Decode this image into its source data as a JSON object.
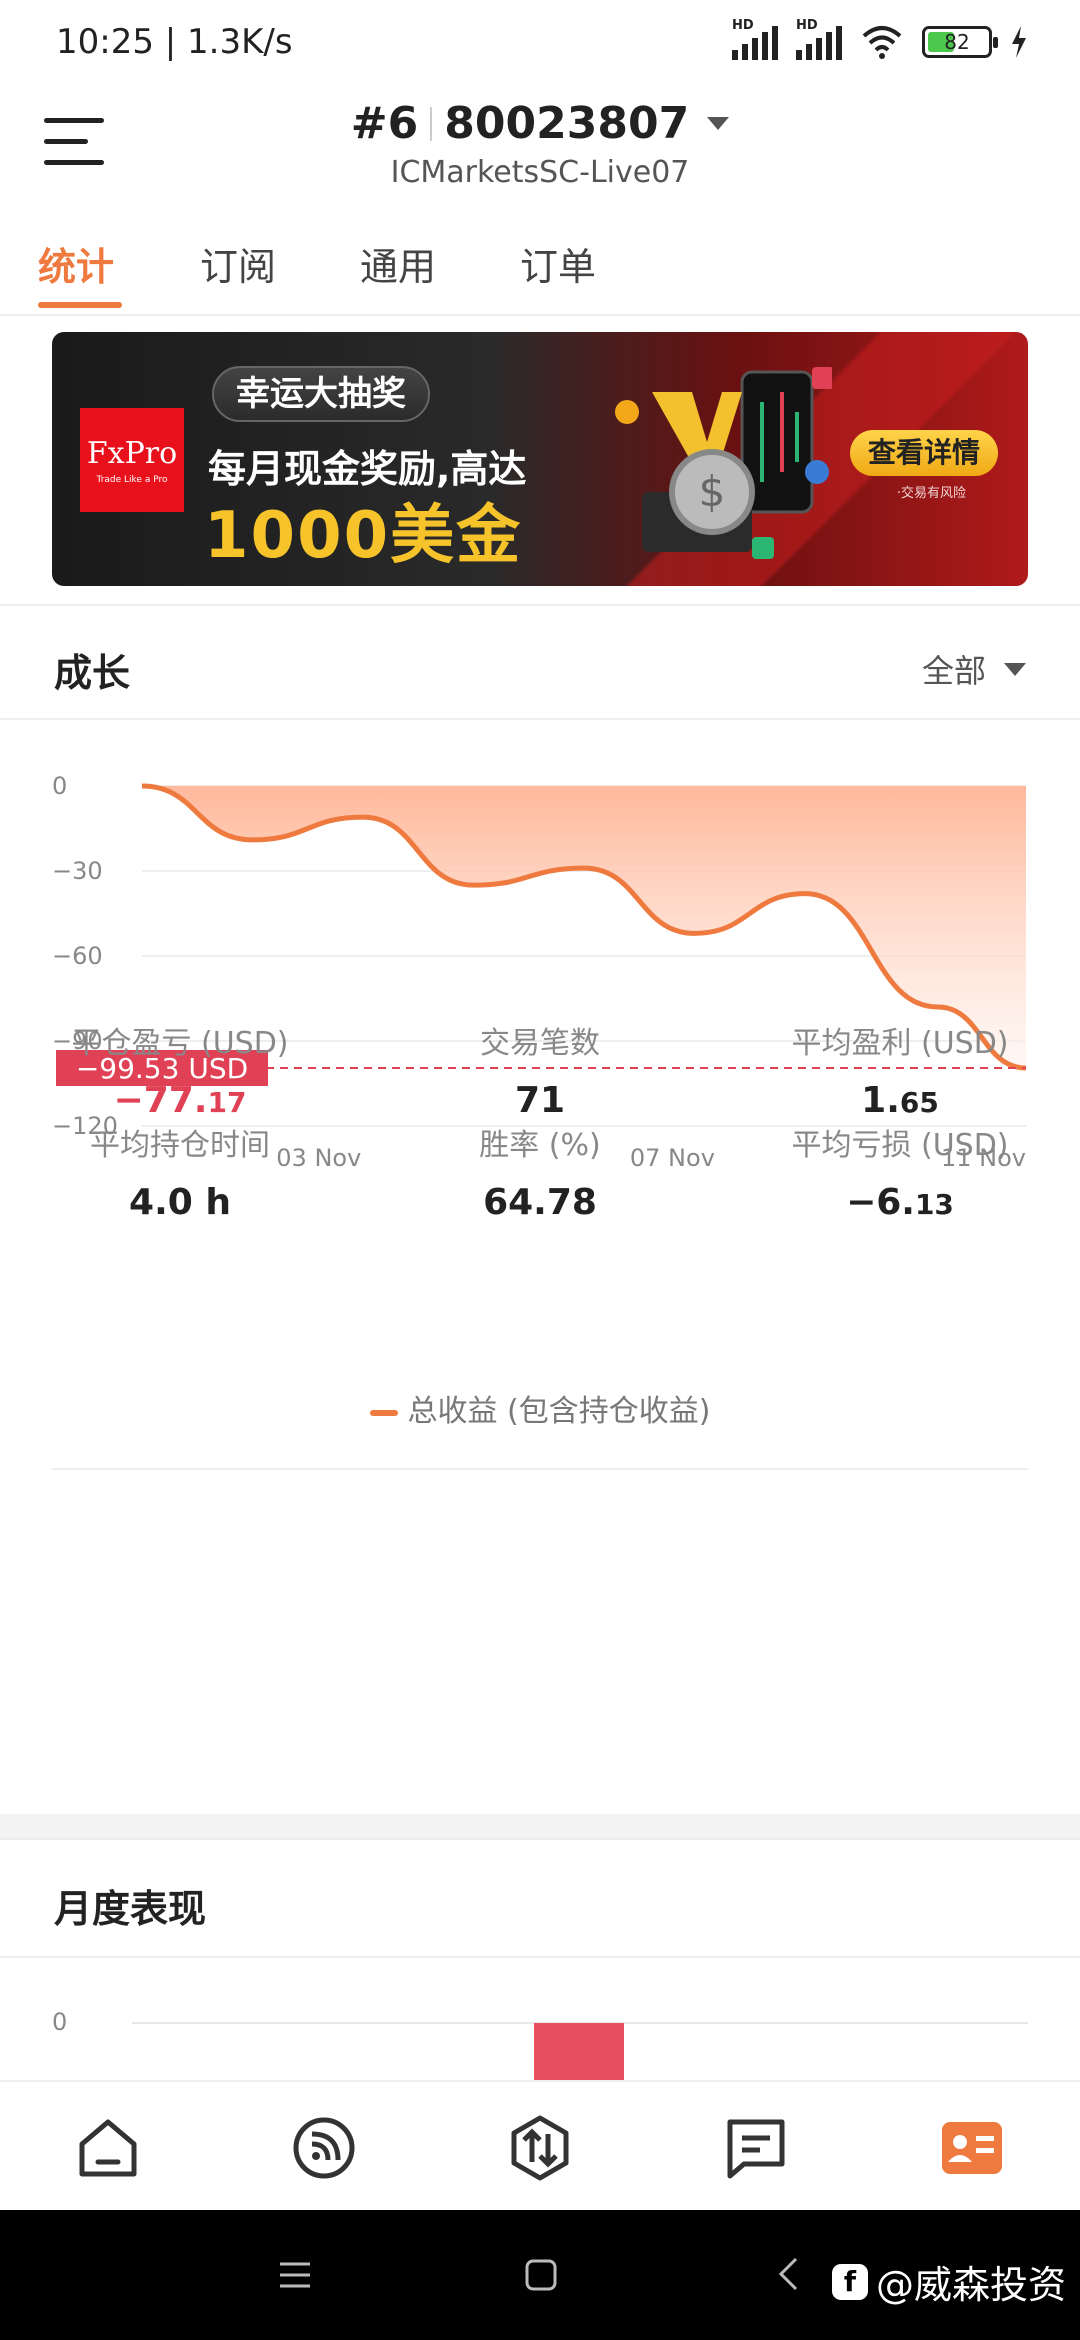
{
  "status_bar": {
    "time": "10:25 | 1.3K/s",
    "hd1": "HD",
    "hd2": "HD",
    "battery": "82"
  },
  "header": {
    "account_num": "#6",
    "account_id": "80023807",
    "server": "ICMarketsSC-Live07"
  },
  "tabs": [
    {
      "label": "统计",
      "active": true
    },
    {
      "label": "订阅",
      "active": false
    },
    {
      "label": "通用",
      "active": false
    },
    {
      "label": "订单",
      "active": false
    }
  ],
  "banner": {
    "logo": "FxPro",
    "logo_tagline": "Trade Like a Pro",
    "pill": "幸运大抽奖",
    "line1": "每月现金奖励,高达",
    "line2": "1000美金",
    "button": "查看详情",
    "risk": "·交易有风险"
  },
  "growth": {
    "title": "成长",
    "filter": "全部",
    "current_label": "−99.53 USD",
    "legend": "总收益 (包含持仓收益)"
  },
  "chart_data": {
    "type": "area",
    "x": [
      "01 Nov",
      "02 Nov",
      "03 Nov",
      "04 Nov",
      "05 Nov",
      "06 Nov",
      "07 Nov",
      "08 Nov",
      "09 Nov",
      "10 Nov",
      "11 Nov"
    ],
    "y": [
      0,
      -19,
      -11,
      -35,
      -29,
      -52,
      -38,
      -78,
      -99.53
    ],
    "y_points_x": [
      0,
      1,
      2,
      3,
      4,
      5,
      6,
      7.2,
      8
    ],
    "xticks": [
      "03 Nov",
      "07 Nov",
      "11 Nov"
    ],
    "yticks": [
      0,
      -30,
      -60,
      -90,
      -120
    ],
    "ylim": [
      -120,
      0
    ],
    "reference_line": -99.53,
    "series": [
      {
        "name": "总收益 (包含持仓收益)",
        "color": "#ef7a3f"
      }
    ],
    "grid": true
  },
  "stats": [
    {
      "label": "平仓盈亏 (USD)",
      "value": "−77.",
      "value_small": "17",
      "tone": "red"
    },
    {
      "label": "交易笔数",
      "value": "71",
      "value_small": "",
      "tone": "normal"
    },
    {
      "label": "平均盈利 (USD)",
      "value": "1.",
      "value_small": "65",
      "tone": "normal"
    },
    {
      "label": "平均持仓时间",
      "value": "4.0 h",
      "value_small": "",
      "tone": "normal"
    },
    {
      "label": "胜率 (%)",
      "value": "64.78",
      "value_small": "",
      "tone": "normal"
    },
    {
      "label": "平均亏损 (USD)",
      "value": "−6.",
      "value_small": "13",
      "tone": "normal"
    }
  ],
  "monthly": {
    "title": "月度表现",
    "zero": "0"
  },
  "bottom_nav": [
    {
      "icon": "home-icon"
    },
    {
      "icon": "signal-icon"
    },
    {
      "icon": "trade-icon"
    },
    {
      "icon": "messages-icon"
    },
    {
      "icon": "profile-card-icon",
      "active": true
    }
  ],
  "watermark": {
    "logo": "f",
    "text": "@威森投资"
  },
  "colors": {
    "accent": "#ef7a3f",
    "negative": "#e04155"
  }
}
